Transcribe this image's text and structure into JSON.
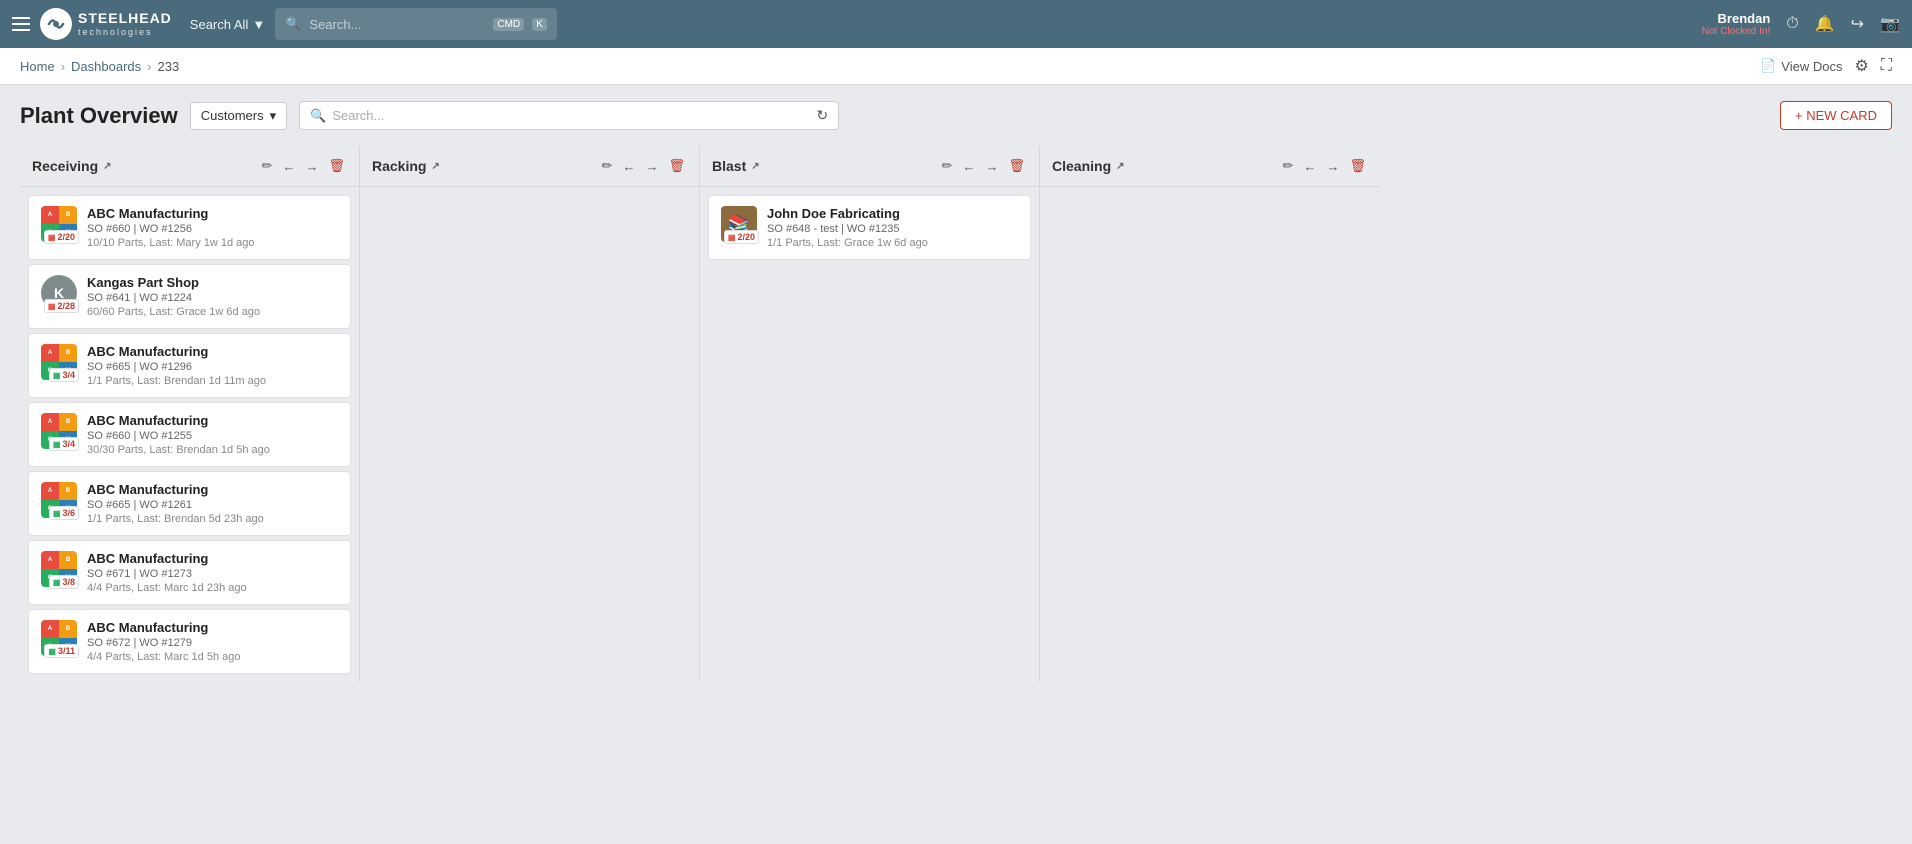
{
  "topNav": {
    "logo_text": "STEELHEAD",
    "logo_sub": "technologies",
    "search_all_label": "Search All",
    "search_placeholder": "Search...",
    "kbd1": "CMD",
    "kbd2": "K",
    "user_name": "Brendan",
    "user_status": "Not Clocked In!",
    "icons": [
      "clock-icon",
      "bell-icon",
      "logout-icon",
      "camera-icon"
    ]
  },
  "breadcrumb": {
    "home": "Home",
    "dashboards": "Dashboards",
    "current": "233",
    "view_docs": "View Docs"
  },
  "page": {
    "title": "Plant Overview",
    "filter_label": "Customers",
    "search_placeholder": "Search...",
    "new_card_label": "+ NEW CARD"
  },
  "columns": [
    {
      "id": "receiving",
      "title": "Receiving",
      "cards": [
        {
          "company": "ABC Manufacturing",
          "so": "SO #660",
          "wo": "WO #1256",
          "parts": "10/10 Parts, Last: Mary 1w 1d ago",
          "date": "2/20",
          "avatar_type": "abc"
        },
        {
          "company": "Kangas Part Shop",
          "so": "SO #641",
          "wo": "WO #1224",
          "parts": "60/60 Parts, Last: Grace 1w 6d ago",
          "date": "2/28",
          "avatar_type": "letter",
          "letter": "K"
        },
        {
          "company": "ABC Manufacturing",
          "so": "SO #665",
          "wo": "WO #1296",
          "parts": "1/1 Parts, Last: Brendan 1d 11m ago",
          "date": "3/4",
          "avatar_type": "abc"
        },
        {
          "company": "ABC Manufacturing",
          "so": "SO #660",
          "wo": "WO #1255",
          "parts": "30/30 Parts, Last: Brendan 1d 5h ago",
          "date": "3/4",
          "avatar_type": "abc"
        },
        {
          "company": "ABC Manufacturing",
          "so": "SO #665",
          "wo": "WO #1261",
          "parts": "1/1 Parts, Last: Brendan 5d 23h ago",
          "date": "3/6",
          "avatar_type": "abc"
        },
        {
          "company": "ABC Manufacturing",
          "so": "SO #671",
          "wo": "WO #1273",
          "parts": "4/4 Parts, Last: Marc 1d 23h ago",
          "date": "3/8",
          "avatar_type": "abc"
        },
        {
          "company": "ABC Manufacturing",
          "so": "SO #672",
          "wo": "WO #1279",
          "parts": "4/4 Parts, Last: Marc 1d 5h ago",
          "date": "3/11",
          "avatar_type": "abc"
        }
      ]
    },
    {
      "id": "racking",
      "title": "Racking",
      "cards": []
    },
    {
      "id": "blast",
      "title": "Blast",
      "cards": [
        {
          "company": "John Doe Fabricating",
          "so": "SO #648 - test",
          "wo": "WO #1235",
          "parts": "1/1 Parts, Last: Grace 1w 6d ago",
          "date": "2/20",
          "avatar_type": "parts"
        }
      ]
    },
    {
      "id": "cleaning",
      "title": "Cleaning",
      "cards": []
    }
  ],
  "calendar_color_green": "#27ae60",
  "calendar_color_red": "#e74c3c"
}
